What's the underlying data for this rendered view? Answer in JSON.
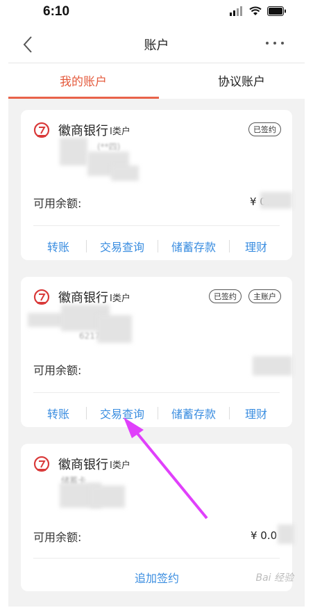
{
  "status_bar": {
    "time": "6:10"
  },
  "nav": {
    "title": "账户"
  },
  "tabs": [
    {
      "label": "我的账户",
      "active": true
    },
    {
      "label": "协议账户",
      "active": false
    }
  ],
  "cards": [
    {
      "bank_name": "徽商银行",
      "account_class": "I类户",
      "badges": [
        "已签约"
      ],
      "blurred_text": "(**四)",
      "balance_label": "可用余额:",
      "balance_value": "¥ 0.",
      "actions": [
        "转账",
        "交易查询",
        "储蓄存款",
        "理财"
      ]
    },
    {
      "bank_name": "徽商银行",
      "account_class": "I类户",
      "badges": [
        "已签约",
        "主账户"
      ],
      "blurred_text": "6217 ***",
      "balance_label": "可用余额:",
      "balance_value": "",
      "actions": [
        "转账",
        "交易查询",
        "储蓄存款",
        "理财"
      ]
    },
    {
      "bank_name": "徽商银行",
      "account_class": "I类户",
      "badges": [],
      "blurred_text": "储蓄卡",
      "balance_label": "可用余额:",
      "balance_value": "¥ 0.0",
      "actions": [
        "追加签约"
      ]
    }
  ],
  "watermark": "Bai 经验",
  "colors": {
    "accent": "#e45a3c",
    "link": "#3a8de0",
    "arrow": "#e040fb"
  }
}
